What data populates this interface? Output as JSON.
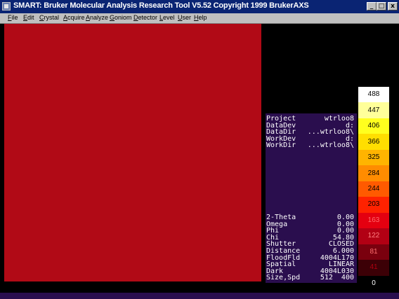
{
  "window": {
    "title": "SMART: Bruker Molecular Analysis Research Tool V5.52 Copyright 1999 BrukerAXS",
    "buttons": {
      "minimize": "_",
      "maximize": "□",
      "close": "x"
    }
  },
  "menu": [
    {
      "label": "File",
      "underline": "F",
      "rest": "ile"
    },
    {
      "label": "Edit",
      "underline": "E",
      "rest": "dit"
    },
    {
      "label": "Crystal",
      "underline": "C",
      "rest": "rystal"
    },
    {
      "label": "Acquire",
      "underline": "A",
      "rest": "cquire"
    },
    {
      "label": "Analyze",
      "underline": "A",
      "rest": "nalyze"
    },
    {
      "label": "Goniom",
      "underline": "G",
      "rest": "oniom"
    },
    {
      "label": "Detector",
      "underline": "D",
      "rest": "etector"
    },
    {
      "label": "Level",
      "underline": "L",
      "rest": "evel"
    },
    {
      "label": "User",
      "underline": "U",
      "rest": "ser"
    },
    {
      "label": "Help",
      "underline": "H",
      "rest": "elp"
    }
  ],
  "image": {
    "color": "#b10a16"
  },
  "project_info": [
    {
      "label": "Project",
      "value": "wtrloo8"
    },
    {
      "label": "DataDev",
      "value": "d:"
    },
    {
      "label": "DataDir",
      "value": "...wtrloo8\\"
    },
    {
      "label": "WorkDev",
      "value": "d:"
    },
    {
      "label": "WorkDir",
      "value": "...wtrloo8\\"
    }
  ],
  "goniometer_info": [
    {
      "label": "2-Theta",
      "value": "0.00"
    },
    {
      "label": "Omega",
      "value": "0.00"
    },
    {
      "label": "Phi",
      "value": "0.00"
    },
    {
      "label": "Chi",
      "value": "54.80"
    },
    {
      "label": "Shutter",
      "value": "CLOSED"
    },
    {
      "label": "Distance",
      "value": "6.000"
    },
    {
      "label": "FloodFld",
      "value": "4004L170"
    },
    {
      "label": "Spatial",
      "value": "LINEAR"
    },
    {
      "label": "Dark",
      "value": "4004L030"
    },
    {
      "label": "Size,Spd",
      "value": "512  400"
    }
  ],
  "color_scale": [
    {
      "label": "488",
      "bg": "#ffffff",
      "fg": "#000000"
    },
    {
      "label": "447",
      "bg": "#ffff9a",
      "fg": "#000000"
    },
    {
      "label": "406",
      "bg": "#ffff1e",
      "fg": "#000000"
    },
    {
      "label": "366",
      "bg": "#ffde00",
      "fg": "#000000"
    },
    {
      "label": "325",
      "bg": "#ffb400",
      "fg": "#000000"
    },
    {
      "label": "284",
      "bg": "#ff8c00",
      "fg": "#000000"
    },
    {
      "label": "244",
      "bg": "#ff5a00",
      "fg": "#000000"
    },
    {
      "label": "203",
      "bg": "#ff2200",
      "fg": "#000000"
    },
    {
      "label": "163",
      "bg": "#e40010",
      "fg": "#ff6a6a"
    },
    {
      "label": "122",
      "bg": "#b20014",
      "fg": "#ff8080"
    },
    {
      "label": "81",
      "bg": "#7a000e",
      "fg": "#ff7070"
    },
    {
      "label": "41",
      "bg": "#3c0006",
      "fg": "#b00010"
    },
    {
      "label": "0",
      "bg": "#000000",
      "fg": "#ffffff"
    }
  ]
}
